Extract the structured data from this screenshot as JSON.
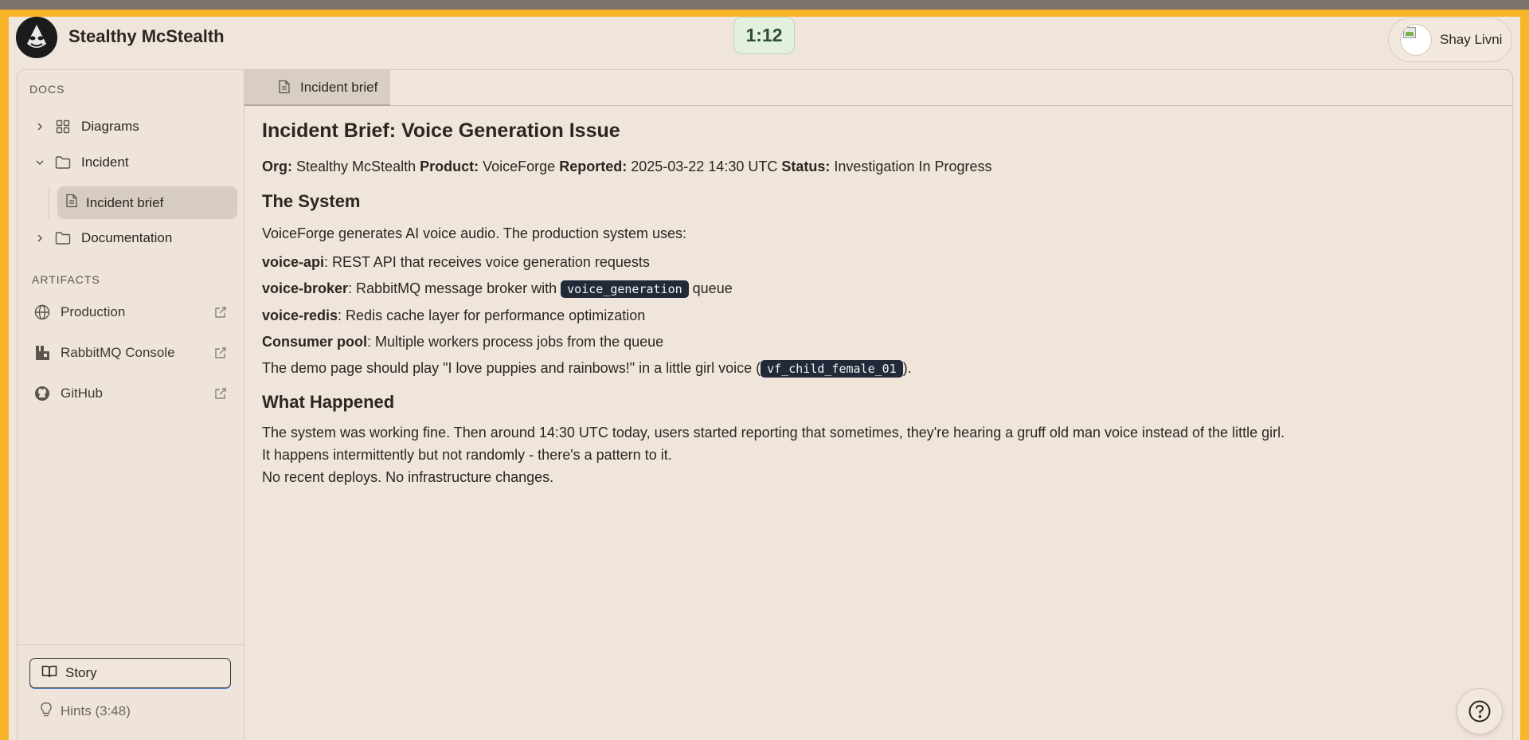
{
  "header": {
    "app_title": "Stealthy McStealth",
    "timer": "1:12",
    "user_name": "Shay Livni"
  },
  "sidebar": {
    "docs_label": "DOCS",
    "tree": [
      {
        "label": "Diagrams",
        "icon": "grid-icon",
        "expanded": false
      },
      {
        "label": "Incident",
        "icon": "folder-icon",
        "expanded": true
      },
      {
        "label": "Incident brief",
        "icon": "file-text-icon",
        "selected": true
      },
      {
        "label": "Documentation",
        "icon": "folder-icon",
        "expanded": false
      }
    ],
    "artifacts_label": "ARTIFACTS",
    "artifacts": [
      {
        "label": "Production",
        "icon": "globe-icon"
      },
      {
        "label": "RabbitMQ Console",
        "icon": "rabbitmq-icon"
      },
      {
        "label": "GitHub",
        "icon": "github-icon"
      }
    ],
    "story_label": "Story",
    "hints_label": "Hints (3:48)"
  },
  "tabs": [
    {
      "label": "Incident brief",
      "active": true
    }
  ],
  "doc": {
    "title": "Incident Brief: Voice Generation Issue",
    "meta": {
      "org_key": "Org:",
      "org": "Stealthy McStealth",
      "product_key": "Product:",
      "product": "VoiceForge",
      "reported_key": "Reported:",
      "reported": "2025-03-22 14:30 UTC",
      "status_key": "Status:",
      "status": "Investigation In Progress"
    },
    "system_heading": "The System",
    "system_intro": "VoiceForge generates AI voice audio. The production system uses:",
    "components": [
      {
        "name": "voice-api",
        "desc": ": REST API that receives voice generation requests"
      },
      {
        "name": "voice-broker",
        "desc_pre": ": RabbitMQ message broker with ",
        "code": "voice_generation",
        "desc_post": " queue"
      },
      {
        "name": "voice-redis",
        "desc": ": Redis cache layer for performance optimization"
      },
      {
        "name": "Consumer pool",
        "desc": ": Multiple workers process jobs from the queue"
      }
    ],
    "demo_pre": "The demo page should play \"I love puppies and rainbows!\" in a little girl voice (",
    "demo_code": "vf_child_female_01",
    "demo_post": ").",
    "happened_heading": "What Happened",
    "happened": [
      "The system was working fine. Then around 14:30 UTC today, users started reporting that sometimes, they're hearing a gruff old man voice instead of the little girl.",
      "It happens intermittently but not randomly - there's a pattern to it.",
      "No recent deploys. No infrastructure changes."
    ]
  },
  "colors": {
    "frame": "#f8b52c",
    "background": "#f0e5db",
    "selected": "#d7ccc1",
    "code_bg": "#222a3a",
    "timer_bg": "#e3f0e0"
  }
}
